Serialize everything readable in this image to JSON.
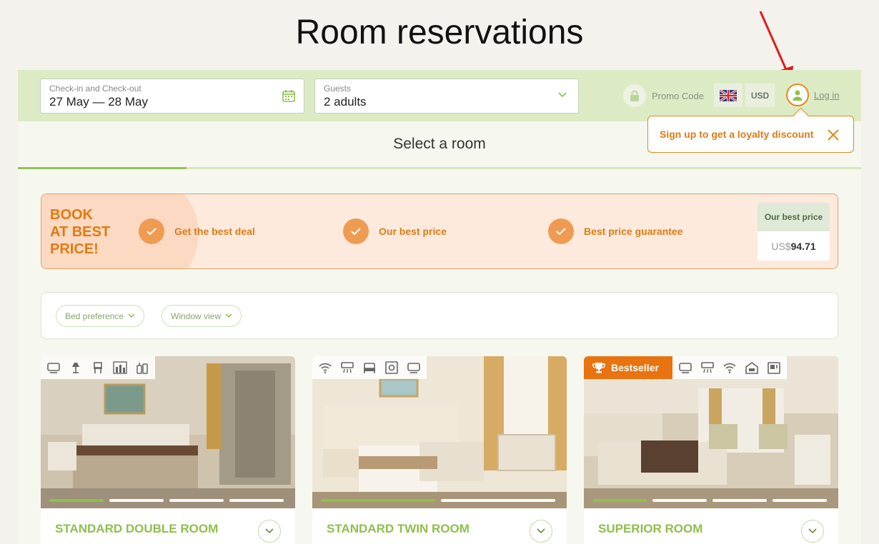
{
  "page": {
    "title": "Room reservations"
  },
  "search": {
    "dates_label": "Check-in and Check-out",
    "dates_value": "27 May — 28 May",
    "guests_label": "Guests",
    "guests_value": "2 adults",
    "calendar_icon": "calendar-icon",
    "dropdown_icon": "chevron-down-icon"
  },
  "header": {
    "promo_label": "Promo Code",
    "promo_icon": "lock-icon",
    "language_icon": "uk-flag-icon",
    "currency": "USD",
    "login_label": "Log in",
    "login_icon": "user-icon"
  },
  "tooltip": {
    "text": "Sign up to get a loyalty discount",
    "close_icon": "close-icon"
  },
  "section": {
    "title": "Select a room"
  },
  "banner": {
    "headline_1": "BOOK",
    "headline_2": "AT BEST",
    "headline_3": "PRICE!",
    "benefits": [
      "Get the best deal",
      "Our best price",
      "Best price guarantee"
    ],
    "best_price_label": "Our best price",
    "best_price_currency": "US$",
    "best_price_value": "94.71"
  },
  "filters": {
    "bed": "Bed preference",
    "window": "Window view"
  },
  "rooms": [
    {
      "name": "STANDARD DOUBLE ROOM",
      "amenities": [
        "tv-icon",
        "lamp-icon",
        "chair-icon",
        "city-view-icon",
        "toiletries-icon"
      ]
    },
    {
      "name": "STANDARD TWIN ROOM",
      "amenities": [
        "wifi-icon",
        "ac-icon",
        "bed-icon",
        "safe-icon",
        "tv-icon"
      ]
    },
    {
      "name": "SUPERIOR ROOM",
      "badge": "Bestseller",
      "badge_icon": "trophy-icon",
      "amenities": [
        "tv-icon",
        "ac-icon",
        "wifi-icon",
        "hotel-icon",
        "minibar-icon"
      ]
    }
  ],
  "colors": {
    "accent_green": "#8ec04a",
    "accent_orange": "#e07b12",
    "header_bg": "#dcebc4"
  }
}
